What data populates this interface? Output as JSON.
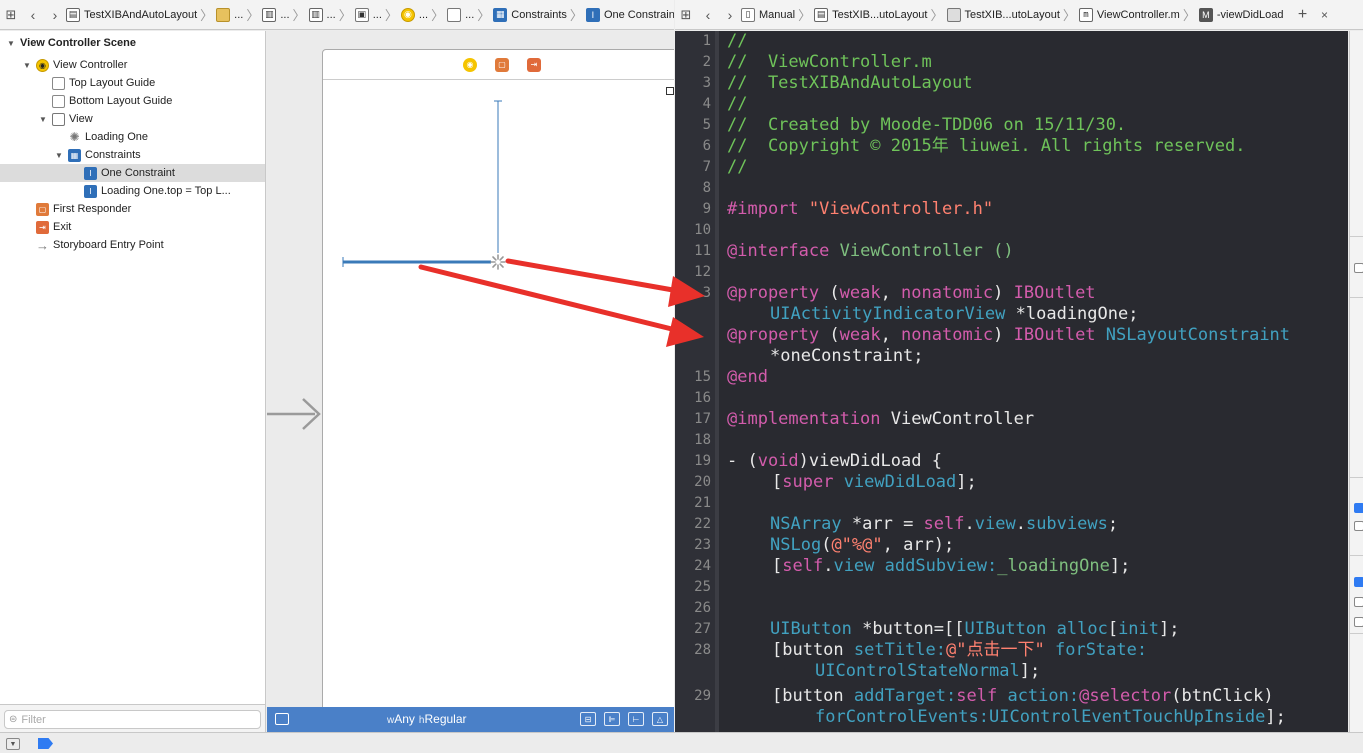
{
  "left_jumpbar": {
    "project": "TestXIBAndAutoLayout",
    "ellipsis": "...",
    "constraints": "Constraints",
    "one_constraint": "One Constraint"
  },
  "right_jumpbar": {
    "mode": "Manual",
    "group": "TestXIB...utoLayout",
    "folder": "TestXIB...utoLayout",
    "file": "ViewController.m",
    "method": "-viewDidLoad",
    "add": "+"
  },
  "outline": {
    "items": [
      {
        "label": "View Controller Scene",
        "icon": "scene-disclosure"
      },
      {
        "label": "View Controller",
        "icon": "view-controller-icon"
      },
      {
        "label": "Top Layout Guide",
        "icon": "layout-guide-icon"
      },
      {
        "label": "Bottom Layout Guide",
        "icon": "layout-guide-icon"
      },
      {
        "label": "View",
        "icon": "view-icon"
      },
      {
        "label": "Loading One",
        "icon": "activity-indicator-icon"
      },
      {
        "label": "Constraints",
        "icon": "constraints-icon"
      },
      {
        "label": "One Constraint",
        "icon": "constraint-icon"
      },
      {
        "label": "Loading One.top = Top L...",
        "icon": "constraint-icon"
      },
      {
        "label": "First Responder",
        "icon": "first-responder-icon"
      },
      {
        "label": "Exit",
        "icon": "exit-icon"
      },
      {
        "label": "Storyboard Entry Point",
        "icon": "entry-point-arrow-icon"
      }
    ],
    "filter_placeholder": "Filter"
  },
  "canvas": {
    "size_class": {
      "w_prefix": "w",
      "w_value": "Any",
      "h_prefix": "h",
      "h_value": "Regular"
    }
  },
  "code": {
    "lines": [
      {
        "n": "1"
      },
      {
        "n": "2"
      },
      {
        "n": "3"
      },
      {
        "n": "4"
      },
      {
        "n": "5"
      },
      {
        "n": "6"
      },
      {
        "n": "7"
      },
      {
        "n": "8"
      },
      {
        "n": "9"
      },
      {
        "n": "10"
      },
      {
        "n": "11"
      },
      {
        "n": "12"
      },
      {
        "n": "3"
      },
      {
        "n": ""
      },
      {
        "n": "15"
      },
      {
        "n": "16"
      },
      {
        "n": "17"
      },
      {
        "n": "18"
      },
      {
        "n": "19"
      },
      {
        "n": "20"
      },
      {
        "n": "21"
      },
      {
        "n": "22"
      },
      {
        "n": "23"
      },
      {
        "n": "24"
      },
      {
        "n": "25"
      },
      {
        "n": "26"
      },
      {
        "n": "27"
      },
      {
        "n": "28"
      },
      {
        "n": "29"
      }
    ],
    "t": {
      "l1": "//",
      "l2": "//  ViewController.m",
      "l3": "//  TestXIBAndAutoLayout",
      "l4": "//",
      "l5": "//  Created by Moode-TDD06 on 15/11/30.",
      "l6": "//  Copyright © 2015年 liuwei. All rights reserved.",
      "l7": "//",
      "import_kw": "#import",
      "import_str": "\"ViewController.h\"",
      "interface_kw": "@interface",
      "interface_name": " ViewController ()",
      "property": "@property",
      "paren_open": " (",
      "weak": "weak",
      "comma": ", ",
      "nonatomic": "nonatomic",
      "paren_close": ") ",
      "iboutlet": "IBOutlet",
      "uiaiv": "UIActivityIndicatorView",
      "loading_decl": " *loadingOne;",
      "nslc": "NSLayoutConstraint",
      "one_decl": "*oneConstraint;",
      "end": "@end",
      "impl_kw": "@implementation",
      "impl_name": " ViewController",
      "vdl_dash": "- (",
      "void": "void",
      "vdl_name": ")viewDidLoad {",
      "bracket": "[",
      "super": "super",
      "space": " ",
      "vdl_call": "viewDidLoad",
      "close_semi": "];",
      "nsarray": "NSArray",
      "arr_mid": " *arr = ",
      "self": "self",
      "dot": ".",
      "view": "view",
      "subviews": "subviews",
      "semi": ";",
      "nslog": "NSLog",
      "lparen": "(",
      "fmt": "@\"%@\"",
      "log_tail": ", arr);",
      "add_subview": "addSubview:",
      "loading_ivar": "_loadingOne",
      "uibutton": "UIButton",
      "btn_mid": " *button=[[",
      "alloc": "alloc",
      "init": "init",
      "init_tail": "];",
      "btn_open": "[button ",
      "set_title": "setTitle:",
      "title_str": "@\"点击一下\"",
      "for_state": "forState:",
      "state_normal": "UIControlStateNormal",
      "add_target": "addTarget:",
      "action": "action:",
      "selector": "@selector",
      "btn_click": "(btnClick)",
      "for_events": "forControlEvents:",
      "touch_up": "UIControlEventTouchUpInside"
    }
  },
  "colors": {
    "editor_bg": "#292a30",
    "comment": "#6fc35a",
    "keyword": "#d35cac",
    "string": "#ff8170",
    "type": "#41a1c0",
    "size_class_bar": "#4a80c8",
    "arrow": "#e8302a"
  }
}
